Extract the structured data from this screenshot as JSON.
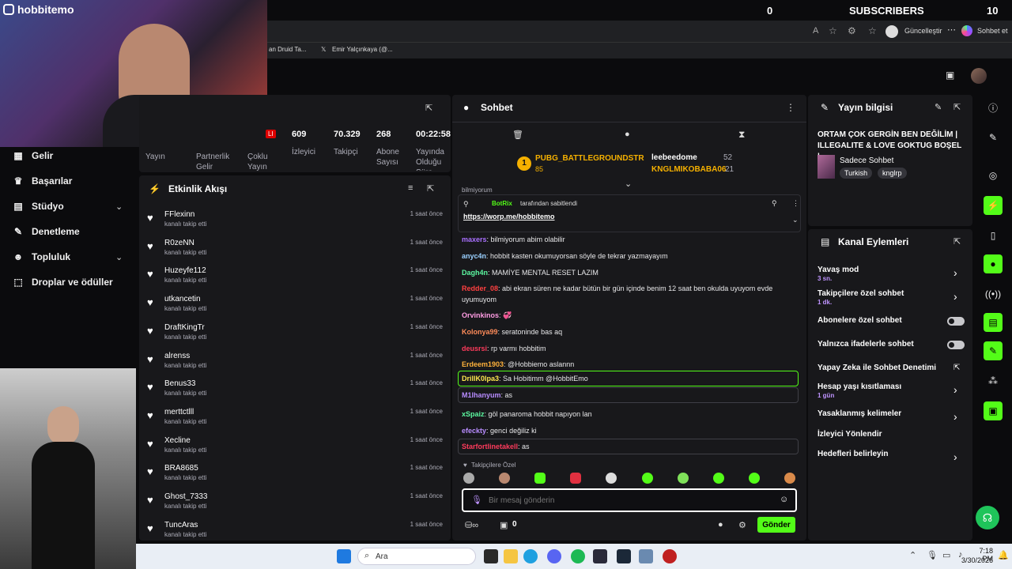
{
  "top": {
    "viewer_count": "0",
    "subscribers_label": "SUBSCRIBERS",
    "subscribers_count": "10"
  },
  "webcam": {
    "username": "hobbitemo"
  },
  "browser": {
    "update_label": "Güncelleştir",
    "chat_label": "Sohbet et",
    "tab1": "an Druid Ta...",
    "tab2": "Emir Yalçınkaya (@..."
  },
  "sidebar": {
    "items": [
      {
        "label": "Gelir",
        "icon": "revenue-icon"
      },
      {
        "label": "Başarılar",
        "icon": "trophy-icon"
      },
      {
        "label": "Stüdyo",
        "icon": "studio-icon"
      },
      {
        "label": "Denetleme",
        "icon": "wrench-icon"
      },
      {
        "label": "Topluluk",
        "icon": "community-icon"
      },
      {
        "label": "Droplar ve ödüller",
        "icon": "drops-icon"
      }
    ]
  },
  "stats": {
    "badge": "LI",
    "values": [
      "609",
      "70.329",
      "268",
      "00:22:58"
    ],
    "labels": [
      "Yayın",
      "Partnerlik\nGelir",
      "Çoklu\nYayın",
      "İzleyici",
      "Takipçi",
      "Abone\nSayısı",
      "Yayında\nOlduğu\nSüre"
    ]
  },
  "activity": {
    "title": "Etkinlik Akışı",
    "sub": "kanalı takip etti",
    "time": "1 saat önce",
    "followers": [
      "FFlexinn",
      "R0zeNN",
      "Huzeyfe112",
      "utkancetin",
      "DraftKingTr",
      "alrenss",
      "Benus33",
      "merttctlll",
      "Xecline",
      "BRA8685",
      "Ghost_7333",
      "TuncAras"
    ]
  },
  "chat": {
    "title": "Sohbet",
    "leaders": [
      {
        "rank": "1",
        "name": "PUBG_BATTLEGROUNDSTR",
        "count": "85"
      },
      {
        "name": "leebeedome",
        "count": "52"
      },
      {
        "name": "KNGLMIKOBABA06",
        "count": "21"
      }
    ],
    "partial_line": "bilmiyorum",
    "pinned": {
      "by": "BotRix",
      "by_suffix": "tarafından sabitlendi",
      "link": "https://worp.me/hobbitemo"
    },
    "messages": [
      {
        "user": "maxers",
        "color": "#a970ff",
        "text": "bilmiyorum abim olabilir"
      },
      {
        "user": "anyc4n",
        "color": "#9ad0ff",
        "text": "hobbit kasten okumuyorsan söyle de tekrar yazmayayım"
      },
      {
        "user": "Dagh4n",
        "color": "#5cf7a0",
        "text": "MAMİYE MENTAL RESET LAZIM"
      },
      {
        "user": "Redder_08",
        "color": "#ff4040",
        "text": "abi ekran süren ne kadar bütün bir gün içinde benim 12 saat ben okulda uyuyom evde uyumuyom"
      },
      {
        "user": "Orvinkinos",
        "color": "#ff9ce3",
        "text": "💞"
      },
      {
        "user": "Kolonya99",
        "color": "#ff8c5a",
        "text": "seratoninde bas aq"
      },
      {
        "user": "deusrsi",
        "color": "#ff3b5c",
        "text": "rp varmı hobbitim"
      },
      {
        "user": "Erdeem1903",
        "color": "#ffb13b",
        "text": "@Hobbiemo aslannn"
      },
      {
        "user": "DrillK0lpa3",
        "color": "#ffe84f",
        "text": "Sa Hobitimm @HobbitEmo"
      },
      {
        "user": "M1lhanyum",
        "color": "#b88cff",
        "text": "as"
      },
      {
        "user": "xSpaiz",
        "color": "#5cf7a0",
        "text": "göl panaroma hobbit napıyon lan"
      },
      {
        "user": "efeckty",
        "color": "#b88cff",
        "text": "genci değiliz ki"
      },
      {
        "user": "Starfortlinetakell",
        "color": "#ff3b5c",
        "text": "as"
      }
    ],
    "followers_only": "Takipçilere Özel",
    "input_placeholder": "Bir mesaj gönderin",
    "bits_count": "0",
    "send_label": "Gönder"
  },
  "stream_info": {
    "title": "Yayın bilgisi",
    "stream_title": "ORTAM ÇOK GERGİN BEN DEĞİLİM | ILLEGALITE & LOVE GOKTUG BOŞEL |...",
    "category": "Sadece Sohbet",
    "tags": [
      "Turkish",
      "knglrp"
    ]
  },
  "channel_actions": {
    "title": "Kanal Eylemleri",
    "items": [
      {
        "label": "Yavaş mod",
        "value": "3 sn.",
        "type": "arrow"
      },
      {
        "label": "Takipçilere özel sohbet",
        "value": "1 dk.",
        "type": "arrow"
      },
      {
        "label": "Abonelere özel sohbet",
        "value": "",
        "type": "toggle"
      },
      {
        "label": "Yalnızca ifadelerle sohbet",
        "value": "",
        "type": "toggle"
      },
      {
        "label": "Yapay Zeka ile Sohbet Denetimi",
        "value": "",
        "type": "external"
      },
      {
        "label": "Hesap yaşı kısıtlaması",
        "value": "1 gün",
        "type": "arrow"
      },
      {
        "label": "Yasaklanmış kelimeler",
        "value": "",
        "type": "arrow"
      },
      {
        "label": "İzleyici Yönlendir",
        "value": "",
        "type": "none"
      },
      {
        "label": "Hedefleri belirleyin",
        "value": "",
        "type": "arrow"
      }
    ]
  },
  "taskbar": {
    "search": "Ara",
    "time": "7:18 PM",
    "date": "3/30/2026"
  },
  "colors": {
    "accent": "#53fc18",
    "purple": "#bf94ff",
    "panel": "#18181b",
    "bg": "#0b0b0d"
  }
}
